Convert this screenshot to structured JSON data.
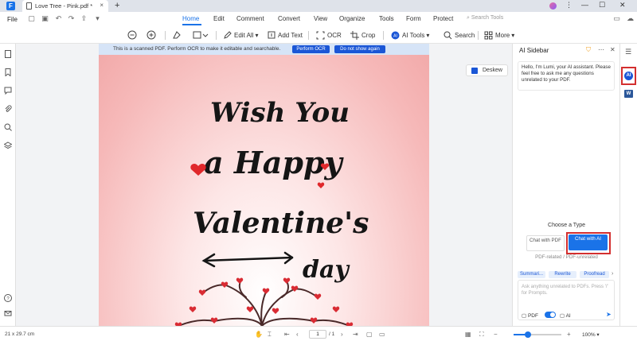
{
  "titlebar": {
    "tab_title": "Love Tree - Pink.pdf *",
    "tab_close": "×",
    "new_tab": "+",
    "window_controls": [
      "⋮",
      "—",
      "☐",
      "✕"
    ]
  },
  "menubar": {
    "file_label": "File",
    "items": [
      "Home",
      "Edit",
      "Comment",
      "Convert",
      "View",
      "Organize",
      "Tools",
      "Form",
      "Protect"
    ],
    "active_item": "Home",
    "search_placeholder": "Search Tools"
  },
  "toolbar": {
    "edit_all": "Edit All",
    "add_text": "Add Text",
    "ocr": "OCR",
    "crop": "Crop",
    "ai_tools": "AI Tools",
    "search": "Search",
    "more": "More"
  },
  "ocr_banner": {
    "message": "This is a scanned PDF. Perform OCR to make it editable and searchable.",
    "perform_ocr": "Perform OCR",
    "do_not_show": "Do not show again"
  },
  "page_art": {
    "line1": "Wish You",
    "line2": "a Happy",
    "line3": "Valentine's",
    "line4": "day"
  },
  "deskew_label": "Deskew",
  "ai_sidebar": {
    "title": "AI Sidebar",
    "greeting": "Hello, I'm Lumi, your AI assistant. Please feel free to ask me any questions unrelated to your PDF.",
    "choose_type": "Choose a Type",
    "chat_with_pdf": "Chat with PDF",
    "chat_with_ai": "Chat with AI",
    "related_note": "PDF-related / PDF-unrelated",
    "chips": [
      "Summari...",
      "Rewrite",
      "Proofread"
    ],
    "input_placeholder": "Ask anything unrelated to PDFs. Press '/' for Prompts.",
    "opt_pdf": "PDF",
    "opt_ai": "AI"
  },
  "statusbar": {
    "page_size": "21 x 29.7 cm",
    "current_page": "1",
    "total_pages": "/ 1",
    "zoom": "100%",
    "zoom_fraction": 0.3
  },
  "colors": {
    "accent": "#1a73e8",
    "highlight_box": "#d32f2f",
    "banner_bg": "#d6e4f7"
  }
}
